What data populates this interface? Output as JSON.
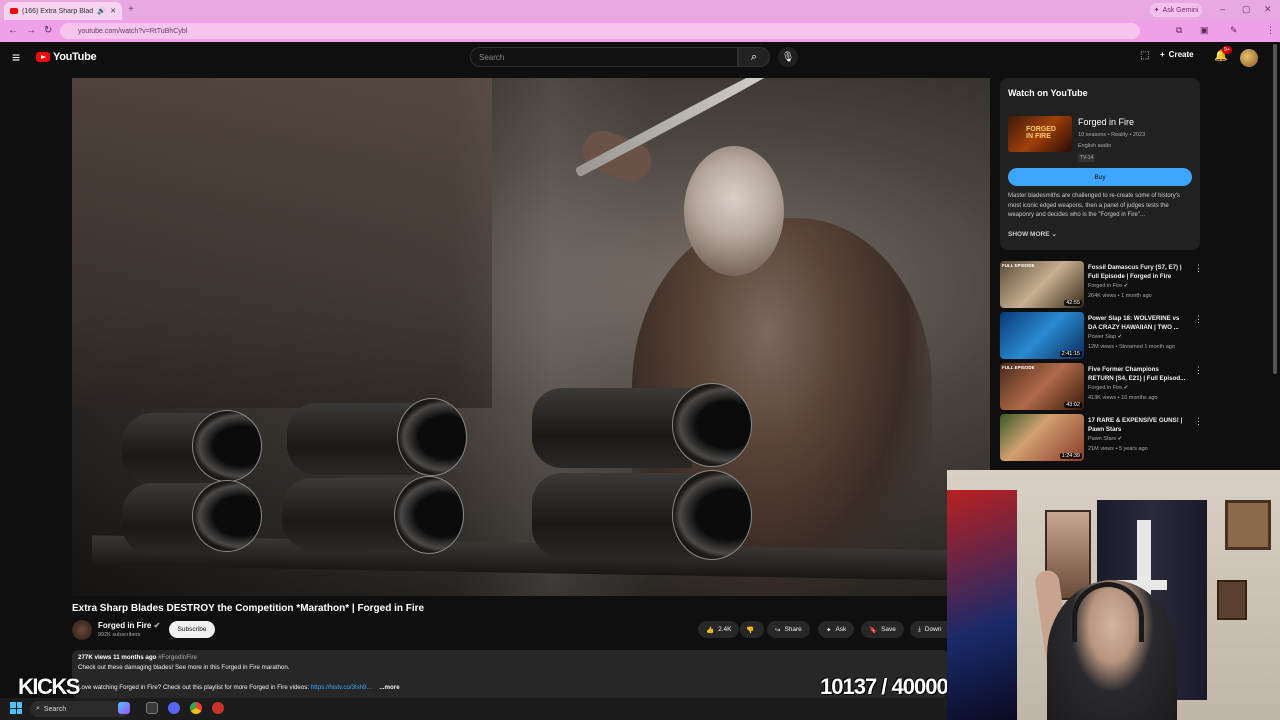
{
  "browser": {
    "tab_title": "(166) Extra Sharp Blades DE...",
    "url": "youtube.com/watch?v=RtTuBhCybl",
    "gemini_label": "Ask Gemini"
  },
  "youtube": {
    "logo_text": "YouTube",
    "search_placeholder": "Search",
    "create_label": "Create",
    "notif_count": "9+"
  },
  "watch_panel": {
    "heading": "Watch on YouTube",
    "show_title": "Forged in Fire",
    "meta1": "10 seasons • Reality • 2023",
    "meta2": "English audio",
    "rating": "TV-14",
    "buy_label": "Buy",
    "description": "Master bladesmiths are challenged to re-create some of history's most iconic edged weapons, then a panel of judges tests the weaponry and decides who is the \"Forged in Fire\"...",
    "show_more": "SHOW MORE"
  },
  "recommendations": [
    {
      "badge": "FULL EPISODE",
      "title": "Fossil Damascus Fury (S7, E7) | Full Episode | Forged in Fire",
      "channel": "Forged in Fire",
      "meta": "264K views • 1 month ago",
      "duration": "42:55"
    },
    {
      "badge": "",
      "title": "Power Slap 18: WOLVERINE vs DA CRAZY HAWAIIAN | TWO ...",
      "channel": "Power Slap",
      "meta": "12M views • Streamed 1 month ago",
      "duration": "2:41:15"
    },
    {
      "badge": "FULL EPISODE",
      "title": "Five Former Champions RETURN (S4, E21) | Full Episod...",
      "channel": "Forged in Fire",
      "meta": "413K views • 10 months ago",
      "duration": "43:02"
    },
    {
      "badge": "",
      "title": "17 RARE & EXPENSIVE GUNS! | Pawn Stars",
      "channel": "Pawn Stars",
      "meta": "21M views • 5 years ago",
      "duration": "1:24:39"
    }
  ],
  "video": {
    "title": "Extra Sharp Blades DESTROY the Competition *Marathon* | Forged in Fire",
    "channel": "Forged in Fire",
    "subscribers": "992K subscribers",
    "subscribe_label": "Subscribe",
    "likes": "2.4K",
    "share_label": "Share",
    "ask_label": "Ask",
    "save_label": "Save",
    "download_label": "Down",
    "views": "277K views",
    "age": "11 months ago",
    "hashtag": "#ForgedInFire",
    "desc_line1": "Check out these damaging blades! See more in this Forged in Fire marathon.",
    "desc_line2": "Love watching Forged in Fire? Check out this playlist for more Forged in Fire videos:",
    "desc_link": "https://histv.co/3lsh9...",
    "more_label": "...more"
  },
  "overlay": {
    "kicks": "KICKS",
    "counter": "10137 / 40000"
  },
  "taskbar": {
    "search_label": "Search"
  }
}
